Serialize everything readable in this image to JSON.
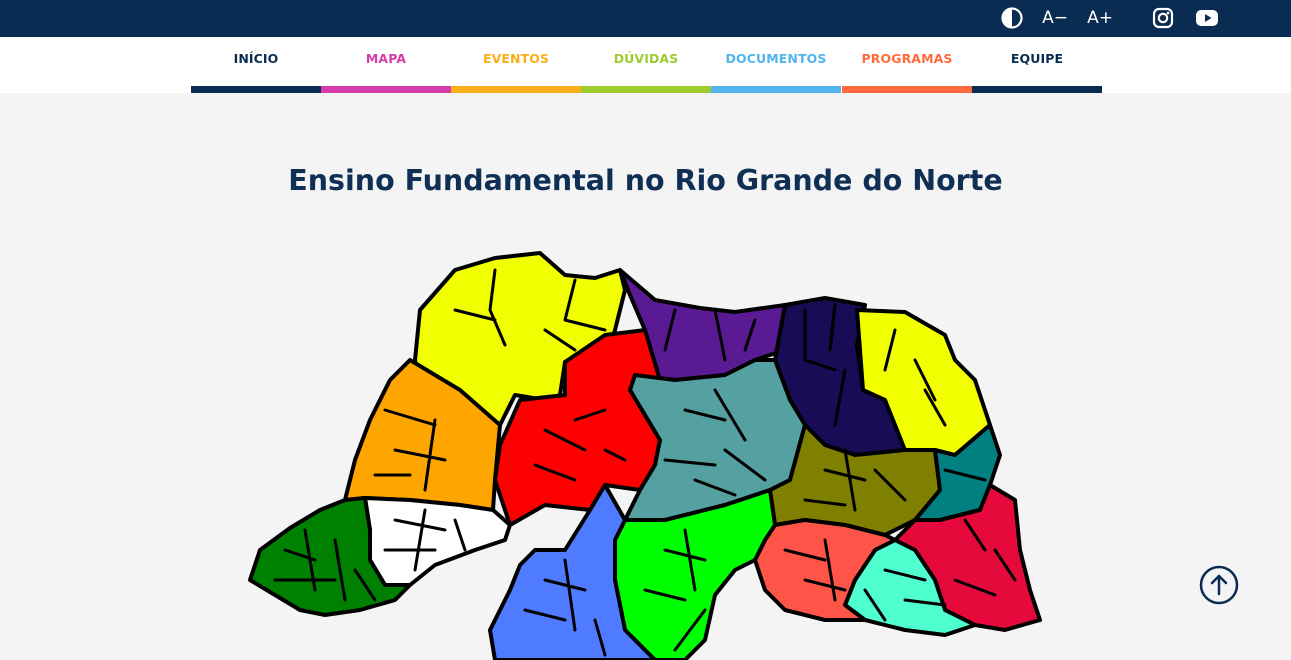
{
  "toolbar": {
    "contrast_icon": "contrast-icon",
    "font_decrease_label": "A−",
    "font_increase_label": "A+",
    "instagram_icon": "instagram-icon",
    "youtube_icon": "youtube-icon"
  },
  "nav": {
    "items": [
      {
        "label": "INÍCIO",
        "color": "#0a2b52"
      },
      {
        "label": "MAPA",
        "color": "#d63bab"
      },
      {
        "label": "EVENTOS",
        "color": "#fbae17"
      },
      {
        "label": "DÚVIDAS",
        "color": "#9ecb2d"
      },
      {
        "label": "DOCUMENTOS",
        "color": "#4fb5ec"
      },
      {
        "label": "PROGRAMAS",
        "color": "#ff6a3c"
      },
      {
        "label": "EQUIPE",
        "color": "#0a2b52"
      }
    ]
  },
  "page": {
    "title": "Ensino Fundamental no Rio Grande do Norte"
  },
  "map": {
    "regions": [
      {
        "name": "region-yellow-northwest",
        "color": "#f2ff00"
      },
      {
        "name": "region-purple-north",
        "color": "#5a1a93"
      },
      {
        "name": "region-navy-north",
        "color": "#170c55"
      },
      {
        "name": "region-yellow-east",
        "color": "#f2ff00"
      },
      {
        "name": "region-orange-west",
        "color": "#ffa500"
      },
      {
        "name": "region-red-center-north",
        "color": "#ff0000"
      },
      {
        "name": "region-teal-center",
        "color": "#55a0a0"
      },
      {
        "name": "region-olive-east",
        "color": "#808000"
      },
      {
        "name": "region-darkcyan-east",
        "color": "#008080"
      },
      {
        "name": "region-crimson-southeast",
        "color": "#e60a3c"
      },
      {
        "name": "region-aquamarine-south",
        "color": "#50ffd0"
      },
      {
        "name": "region-salmon-south",
        "color": "#ff5548"
      },
      {
        "name": "region-green-south",
        "color": "#00ff00"
      },
      {
        "name": "region-blue-south",
        "color": "#4e7bff"
      },
      {
        "name": "region-white-west",
        "color": "#ffffff"
      },
      {
        "name": "region-darkgreen-southwest",
        "color": "#008000"
      }
    ]
  },
  "scroll_top": {
    "icon": "arrow-up-icon"
  }
}
